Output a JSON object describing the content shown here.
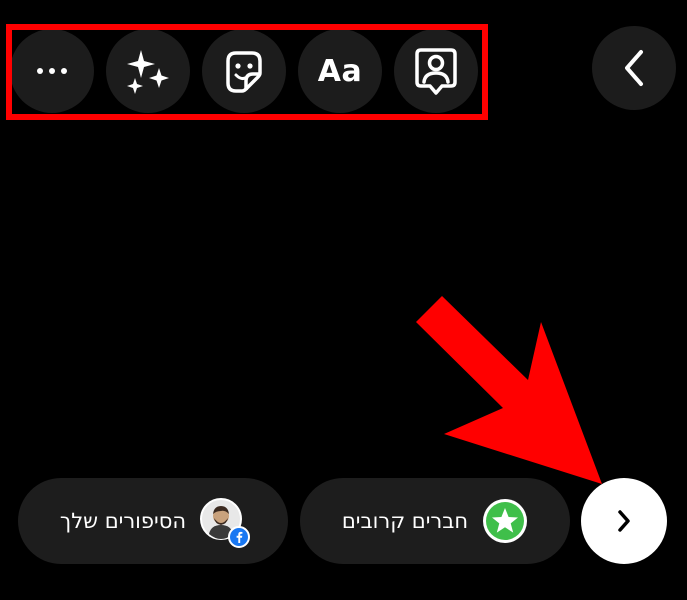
{
  "toolbar": {
    "items": [
      {
        "icon": "more-dots-icon"
      },
      {
        "icon": "sparkles-effects-icon"
      },
      {
        "icon": "sticker-icon"
      },
      {
        "icon": "text-aa-icon",
        "label": "Aa"
      },
      {
        "icon": "mention-person-icon"
      }
    ]
  },
  "back_button": {
    "icon": "chevron-left-icon"
  },
  "share": {
    "your_story_label": "הסיפורים שלך",
    "close_friends_label": "חברים קרובים",
    "next_icon": "chevron-right-icon"
  },
  "colors": {
    "background": "#000000",
    "button_bg": "#1c1c1c",
    "close_friends_green": "#3fbf4a",
    "facebook_blue": "#1877f2",
    "annotation_red": "#ff0000"
  }
}
